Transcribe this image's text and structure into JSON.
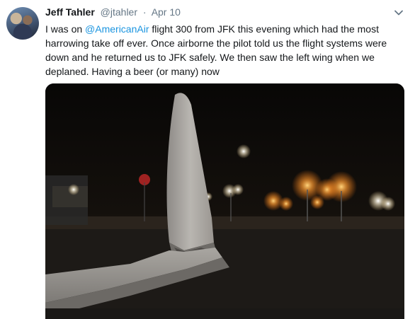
{
  "tweet": {
    "author_name": "Jeff Tahler",
    "author_handle": "@jtahler",
    "separator": "·",
    "timestamp": "Apr 10",
    "text_before": "I was on ",
    "mention": "@AmericanAir",
    "text_after": " flight 300 from JFK this evening which had the most harrowing take off ever.  Once airborne the pilot told us the flight systems were down and he returned us to JFK safely.  We then saw the left wing when we deplaned.  Having a beer (or many) now"
  },
  "icons": {
    "menu": "chevron-down-icon",
    "avatar": "avatar"
  },
  "colors": {
    "link": "#1b95e0",
    "secondary": "#657786",
    "text": "#14171a"
  }
}
